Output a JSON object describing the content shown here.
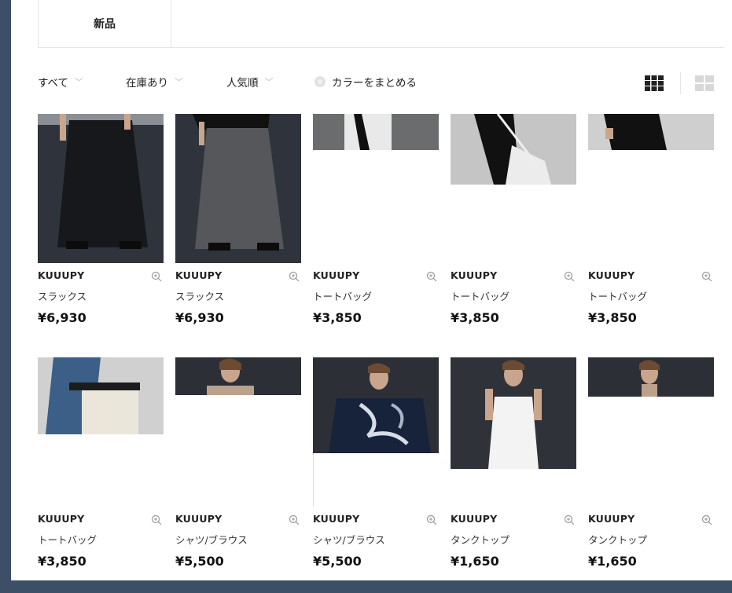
{
  "tabs": {
    "new_label": "新品"
  },
  "filters": {
    "all": "すべて",
    "stock": "在庫あり",
    "sort": "人気順",
    "color_group": "カラーをまとめる"
  },
  "products": [
    {
      "brand": "KUUUPY",
      "name": "スラックス",
      "price": "¥6,930"
    },
    {
      "brand": "KUUUPY",
      "name": "スラックス",
      "price": "¥6,930"
    },
    {
      "brand": "KUUUPY",
      "name": "トートバッグ",
      "price": "¥3,850"
    },
    {
      "brand": "KUUUPY",
      "name": "トートバッグ",
      "price": "¥3,850"
    },
    {
      "brand": "KUUUPY",
      "name": "トートバッグ",
      "price": "¥3,850"
    },
    {
      "brand": "KUUUPY",
      "name": "トートバッグ",
      "price": "¥3,850"
    },
    {
      "brand": "KUUUPY",
      "name": "シャツ/ブラウス",
      "price": "¥5,500"
    },
    {
      "brand": "KUUUPY",
      "name": "シャツ/ブラウス",
      "price": "¥5,500"
    },
    {
      "brand": "KUUUPY",
      "name": "タンクトップ",
      "price": "¥1,650"
    },
    {
      "brand": "KUUUPY",
      "name": "タンクトップ",
      "price": "¥1,650"
    }
  ],
  "icons": {
    "zoom": "zoom-in-icon",
    "grid_dense": "grid-5-icon",
    "grid_loose": "grid-4-icon"
  },
  "colors": {
    "page_bg": "#3d4f66",
    "text": "#222222",
    "muted": "#b8b8b8"
  }
}
